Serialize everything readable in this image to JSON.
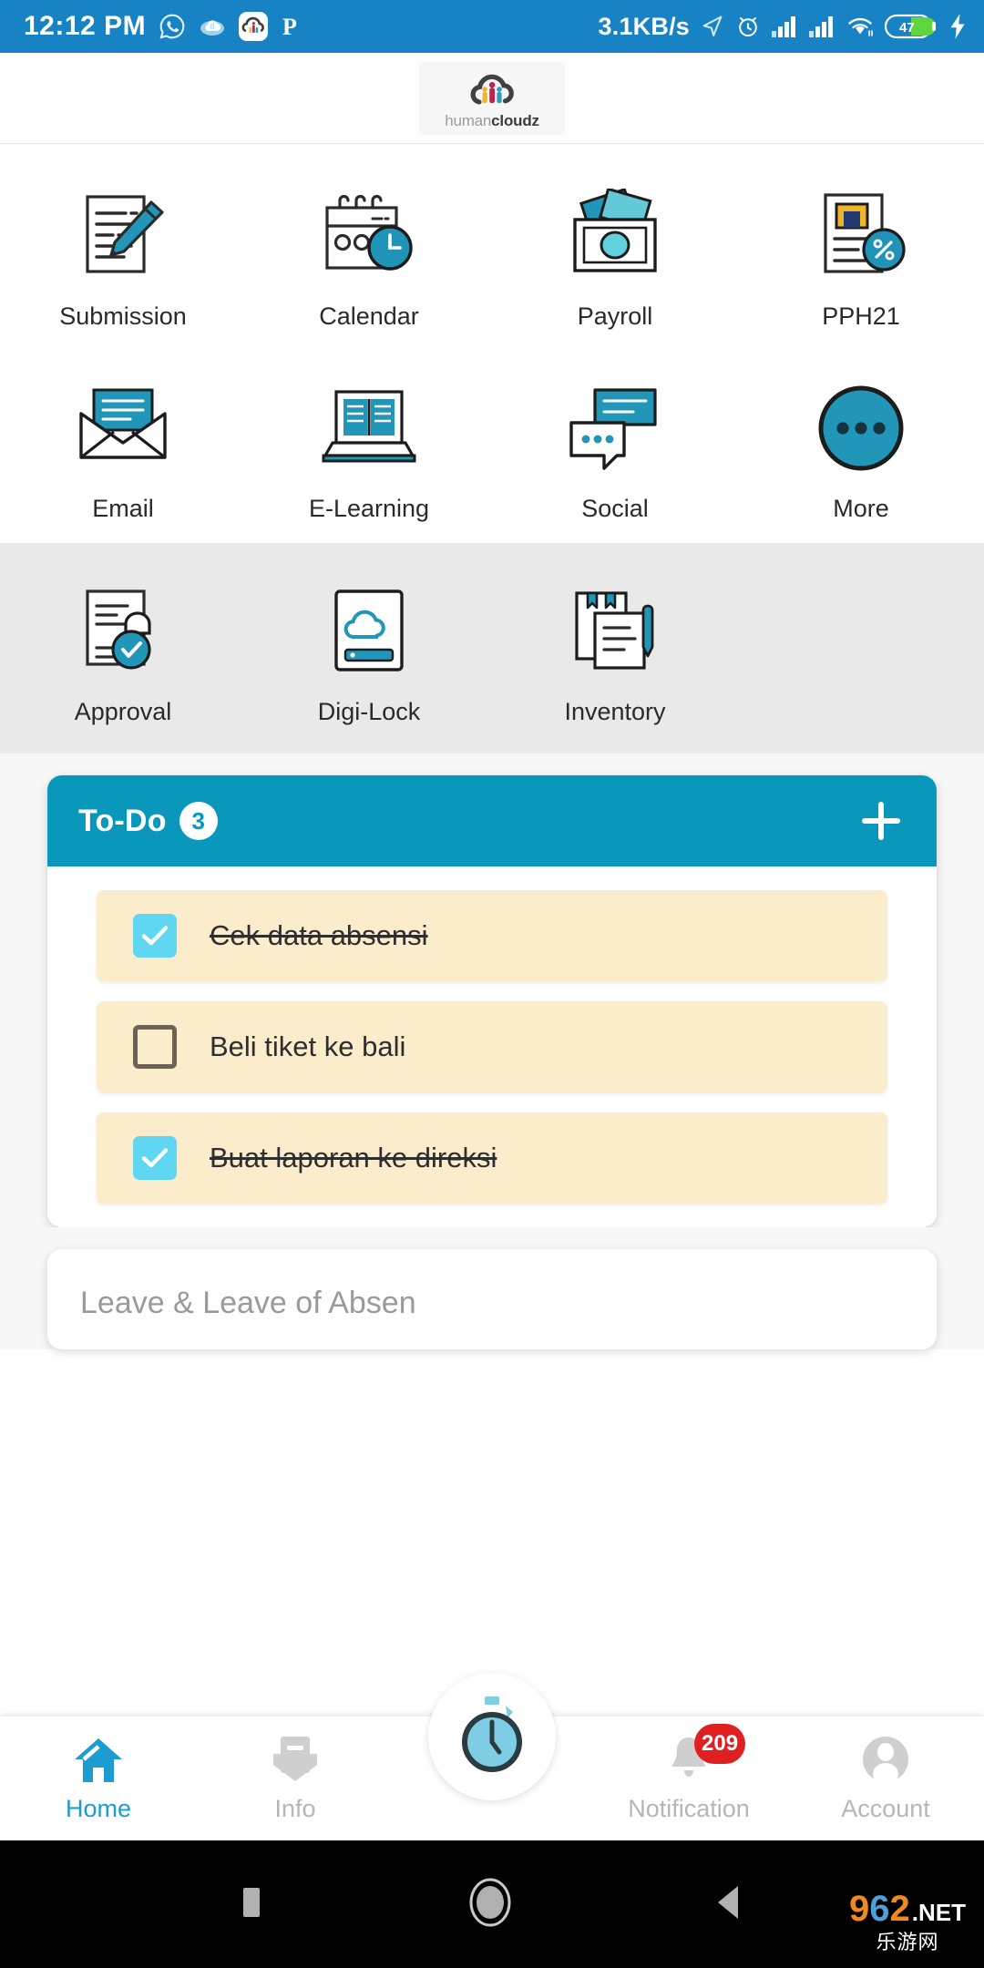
{
  "status_bar": {
    "time": "12:12 PM",
    "network_speed": "3.1KB/s",
    "battery_level": "47",
    "left_icons": [
      "whatsapp-icon",
      "cloud-icon",
      "humancloudz-app-icon",
      "pinterest-icon"
    ],
    "right_icons": [
      "location-arrow-icon",
      "alarm-icon",
      "signal-bars-1-icon",
      "signal-bars-2-icon",
      "wifi-icon",
      "battery-icon",
      "charging-bolt-icon"
    ],
    "background_color": "#1783c4"
  },
  "header": {
    "logo_text_light": "human",
    "logo_text_bold": "cloudz",
    "logo_icon": "cloud-people-logo"
  },
  "menu": {
    "primary_rows": [
      [
        {
          "label": "Submission",
          "icon": "document-pen-icon"
        },
        {
          "label": "Calendar",
          "icon": "calendar-clock-icon"
        },
        {
          "label": "Payroll",
          "icon": "money-cash-icon"
        },
        {
          "label": "PPH21",
          "icon": "tax-document-percent-icon"
        }
      ],
      [
        {
          "label": "Email",
          "icon": "envelope-open-icon"
        },
        {
          "label": "E-Learning",
          "icon": "laptop-book-icon"
        },
        {
          "label": "Social",
          "icon": "chat-bubbles-icon"
        },
        {
          "label": "More",
          "icon": "more-dots-circle-icon"
        }
      ]
    ],
    "secondary_row": [
      {
        "label": "Approval",
        "icon": "document-stamp-icon"
      },
      {
        "label": "Digi-Lock",
        "icon": "cloud-storage-icon"
      },
      {
        "label": "Inventory",
        "icon": "clipboard-pen-icon"
      }
    ]
  },
  "todo": {
    "title": "To-Do",
    "count": "3",
    "add_icon": "plus-icon",
    "header_color": "#0997bc",
    "item_bg_color": "#fbeccc",
    "checkbox_color": "#5fd6f2",
    "items": [
      {
        "text": "Cek data absensi",
        "checked": true
      },
      {
        "text": "Beli tiket ke bali",
        "checked": false
      },
      {
        "text": "Buat laporan ke direksi",
        "checked": true
      }
    ]
  },
  "leave_card": {
    "title": "Leave & Leave of Absen"
  },
  "bottom_nav": {
    "active_color": "#1b9dd1",
    "inactive_color": "#b6b6b6",
    "items": [
      {
        "label": "Home",
        "icon": "home-icon",
        "active": true
      },
      {
        "label": "Info",
        "icon": "info-envelope-icon",
        "active": false
      },
      {
        "label": "",
        "icon": "stopwatch-icon",
        "active": false
      },
      {
        "label": "Notification",
        "icon": "bell-icon",
        "active": false,
        "badge": "209"
      },
      {
        "label": "Account",
        "icon": "account-person-icon",
        "active": false
      }
    ]
  },
  "android_nav": {
    "buttons": [
      "recents-square-icon",
      "home-circle-icon",
      "back-triangle-icon"
    ]
  },
  "watermark": {
    "digit1": "9",
    "digit2": "6",
    "digit3": "2",
    "suffix": ".NET",
    "subtitle": "乐游网"
  }
}
